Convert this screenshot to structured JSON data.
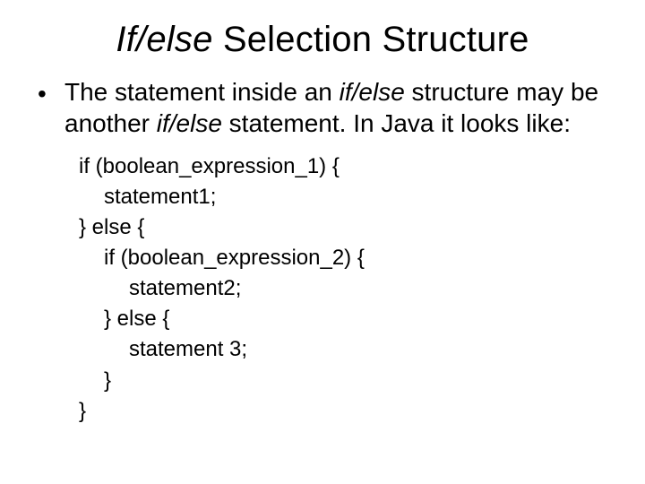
{
  "title_part_italic": "If/else",
  "title_part_rest": " Selection Structure",
  "bullet": {
    "seg1": "The statement inside an ",
    "seg2_italic": "if/else",
    "seg3": " structure may be another ",
    "seg4_italic": "if/else",
    "seg5": " statement. In Java it looks like:"
  },
  "code": {
    "l0": "if (boolean_expression_1) {",
    "l1": "statement1;",
    "l2": "} else {",
    "l3": "if (boolean_expression_2) {",
    "l4": "statement2;",
    "l5": "} else {",
    "l6": "statement 3;",
    "l7": "}",
    "l8": "}"
  },
  "bullet_glyph": "•"
}
